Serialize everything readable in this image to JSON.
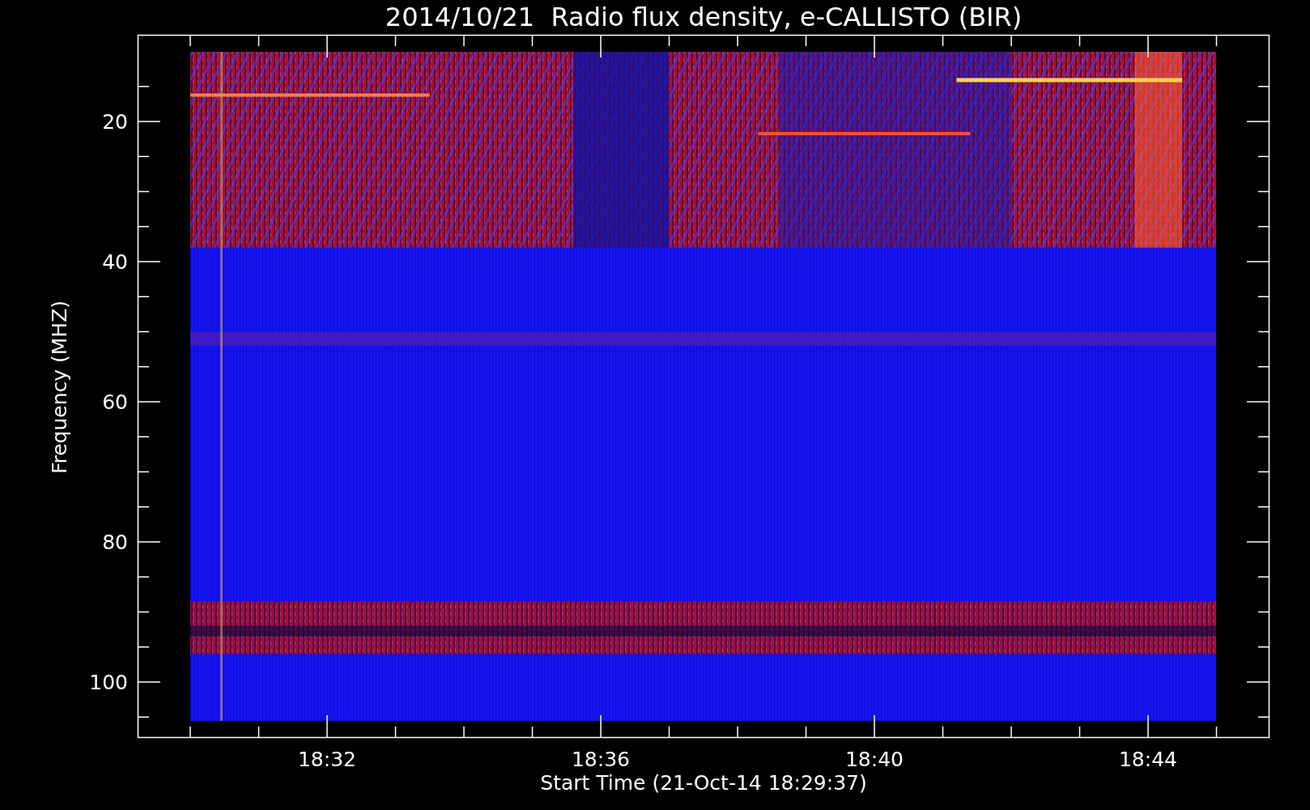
{
  "title": "2014/10/21  Radio flux density, e-CALLISTO (BIR)",
  "y_axis": {
    "label": "Frequency (MHZ)",
    "ticks": [
      "20",
      "40",
      "60",
      "80",
      "100"
    ]
  },
  "x_axis": {
    "label": "Start Time (21-Oct-14 18:29:37)",
    "ticks": [
      "18:32",
      "18:36",
      "18:40",
      "18:44"
    ]
  }
}
